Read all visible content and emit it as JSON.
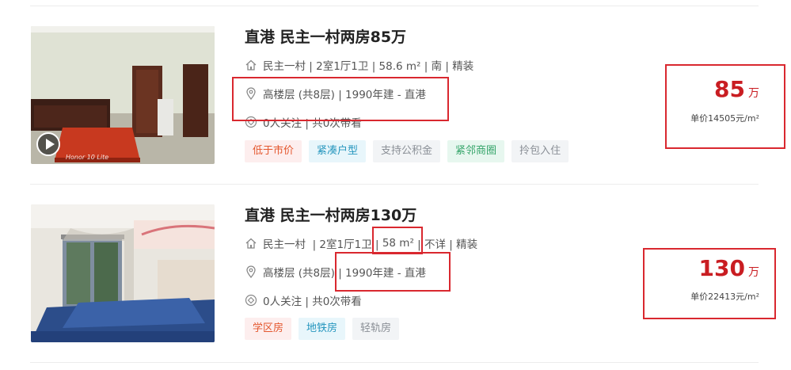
{
  "colors": {
    "price": "#c91d22",
    "highlight_box": "#d9282f"
  },
  "listings": [
    {
      "title": "直港 民主一村两房85万",
      "info_line1": "民主一村  | 2室1厅1卫 | 58.6 m² | 南 | 精装",
      "info_line2": "高楼层 (共8层) | 1990年建 - 直港",
      "info_line3": "0人关注 | 共0次带看",
      "tags": [
        {
          "label": "低于市价",
          "style": "red"
        },
        {
          "label": "紧凑户型",
          "style": "blue"
        },
        {
          "label": "支持公积金",
          "style": "gray"
        },
        {
          "label": "紧邻商圈",
          "style": "green"
        },
        {
          "label": "拎包入住",
          "style": "gray"
        }
      ],
      "price_value": "85",
      "price_unit": "万",
      "unit_price": "单价14505元/m²",
      "watermark": "Honor 10 Lite",
      "icons": [
        "home-icon",
        "location-pin-icon",
        "follow-icon",
        "play-icon"
      ]
    },
    {
      "title": "直港 民主一村两房130万",
      "info_line1_prefix": "民主一村  | 2室1厅1卫 | ",
      "info_line1_area": "58 m²",
      "info_line1_suffix": " | 不详 | 精装",
      "info_line2_prefix": "高楼层 (共8层) | ",
      "info_line2_year": "1990年建 - 直港",
      "info_line3": "0人关注 | 共0次带看",
      "tags": [
        {
          "label": "学区房",
          "style": "red"
        },
        {
          "label": "地铁房",
          "style": "blue"
        },
        {
          "label": "轻轨房",
          "style": "gray"
        }
      ],
      "price_value": "130",
      "price_unit": "万",
      "unit_price": "单价22413元/m²",
      "icons": [
        "home-icon",
        "location-pin-icon",
        "follow-icon"
      ]
    }
  ]
}
